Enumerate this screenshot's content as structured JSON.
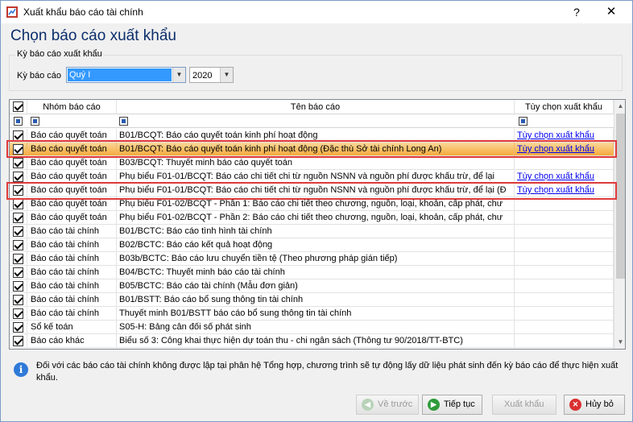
{
  "window": {
    "title": "Xuất khẩu báo cáo tài chính",
    "help": "?",
    "close": "✕"
  },
  "heading": "Chọn báo cáo xuất khẩu",
  "period_group": {
    "legend": "Kỳ báo cáo xuất khẩu",
    "label": "Kỳ báo cáo",
    "period_value": "Quý I",
    "year_value": "2020"
  },
  "grid": {
    "columns": [
      "Nhóm báo cáo",
      "Tên báo cáo",
      "Tùy chọn xuất khẩu"
    ],
    "rows": [
      {
        "checked": true,
        "group": "Báo cáo quyết toán",
        "name": "B01/BCQT: Báo cáo quyết toán kinh phí hoạt động",
        "option": "Tùy chọn xuất khẩu",
        "highlight": false
      },
      {
        "checked": true,
        "group": "Báo cáo quyết toán",
        "name": "B01/BCQT: Báo cáo quyết toán kinh phí hoạt động (Đặc thù Sở tài chính Long An)",
        "option": "Tùy chọn xuất khẩu",
        "highlight": true
      },
      {
        "checked": true,
        "group": "Báo cáo quyết toán",
        "name": "B03/BCQT: Thuyết minh báo cáo quyết toán",
        "option": "",
        "highlight": false
      },
      {
        "checked": true,
        "group": "Báo cáo quyết toán",
        "name": "Phụ biểu F01-01/BCQT: Báo cáo chi tiết chi từ nguồn NSNN và nguồn phí được khấu trừ, để lại",
        "option": "Tùy chọn xuất khẩu",
        "highlight": false
      },
      {
        "checked": true,
        "group": "Báo cáo quyết toán",
        "name": "Phụ biểu F01-01/BCQT: Báo cáo chi tiết chi từ nguồn NSNN và nguồn phí được khấu trừ, để lại (Đ",
        "option": "Tùy chọn xuất khẩu",
        "highlight": false
      },
      {
        "checked": true,
        "group": "Báo cáo quyết toán",
        "name": "Phụ biểu F01-02/BCQT - Phần 1: Báo cáo chi tiết theo chương, nguồn, loại, khoản, cấp phát, chư",
        "option": "",
        "highlight": false
      },
      {
        "checked": true,
        "group": "Báo cáo quyết toán",
        "name": "Phụ biểu F01-02/BCQT - Phần 2: Báo cáo chi tiết theo chương, nguồn, loại, khoản, cấp phát, chư",
        "option": "",
        "highlight": false
      },
      {
        "checked": true,
        "group": "Báo cáo tài chính",
        "name": "B01/BCTC: Báo cáo tình hình tài chính",
        "option": "",
        "highlight": false
      },
      {
        "checked": true,
        "group": "Báo cáo tài chính",
        "name": "B02/BCTC: Báo cáo kết quả hoạt động",
        "option": "",
        "highlight": false
      },
      {
        "checked": true,
        "group": "Báo cáo tài chính",
        "name": "B03b/BCTC: Báo cáo lưu chuyển tiền tệ (Theo phương pháp gián tiếp)",
        "option": "",
        "highlight": false
      },
      {
        "checked": true,
        "group": "Báo cáo tài chính",
        "name": "B04/BCTC: Thuyết minh báo cáo tài chính",
        "option": "",
        "highlight": false
      },
      {
        "checked": true,
        "group": "Báo cáo tài chính",
        "name": "B05/BCTC: Báo cáo tài chính (Mẫu đơn giản)",
        "option": "",
        "highlight": false
      },
      {
        "checked": true,
        "group": "Báo cáo tài chính",
        "name": "B01/BSTT: Báo cáo bổ sung thông tin tài chính",
        "option": "",
        "highlight": false
      },
      {
        "checked": true,
        "group": "Báo cáo tài chính",
        "name": "Thuyết minh B01/BSTT báo cáo bổ sung thông tin tài chính",
        "option": "",
        "highlight": false
      },
      {
        "checked": true,
        "group": "Sổ kế toán",
        "name": "S05-H: Bảng cân đối số phát sinh",
        "option": "",
        "highlight": false
      },
      {
        "checked": true,
        "group": "Báo cáo khác",
        "name": "Biểu số 3: Công khai thực hiện dự toán thu - chi ngân sách (Thông tư 90/2018/TT-BTC)",
        "option": "",
        "highlight": false
      }
    ]
  },
  "info_text": "Đối với các báo cáo tài chính không được lập tại phân hệ Tổng hợp, chương trình sẽ tự động lấy dữ liệu phát sinh đến kỳ báo cáo để thực hiện xuất khẩu.",
  "buttons": {
    "back": "Về trước",
    "next": "Tiếp tục",
    "export": "Xuất khẩu",
    "cancel": "Hủy bỏ"
  },
  "colors": {
    "highlight_row": "#f5a93c",
    "red_outline": "#e03a3a",
    "heading": "#0c2e6b",
    "link": "#0000ee"
  }
}
